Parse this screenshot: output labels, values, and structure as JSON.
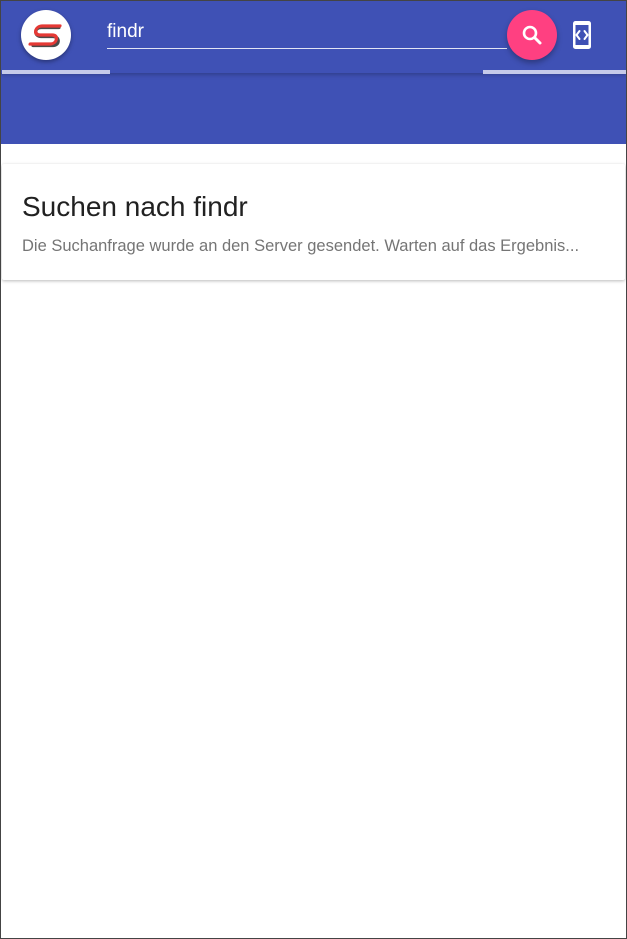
{
  "app": {
    "brand_color": "#3f51b5",
    "accent_color": "#ff4081",
    "logo_icon": "app-logo-s-icon"
  },
  "search": {
    "value": "findr",
    "button_icon": "search-icon"
  },
  "toolbar": {
    "devices_icon": "developer-mode-icon"
  },
  "result_card": {
    "title": "Suchen nach findr",
    "message": "Die Suchanfrage wurde an den Server gesendet. Warten auf das Ergebnis..."
  }
}
